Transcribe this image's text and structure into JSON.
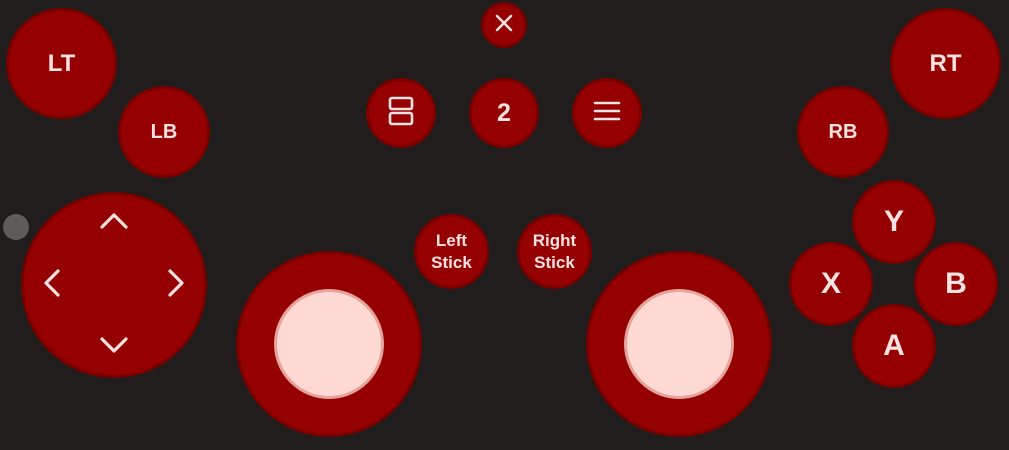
{
  "colors": {
    "background": "#211d1d",
    "button_fill": "#950000",
    "button_border": "#7a0000",
    "button_text": "#fbe1e1",
    "stick_knob": "#ffd9d4",
    "drag_handle": "#5e5b5b"
  },
  "top_controls": {
    "close_icon": "close-icon",
    "view_icon": "view-toggle-icon",
    "page_label": "2",
    "menu_icon": "menu-icon"
  },
  "triggers": {
    "lt": "LT",
    "rt": "RT",
    "lb": "LB",
    "rb": "RB"
  },
  "stick_buttons": {
    "left_line1": "Left",
    "left_line2": "Stick",
    "right_line1": "Right",
    "right_line2": "Stick"
  },
  "face_buttons": {
    "y": "Y",
    "x": "X",
    "b": "B",
    "a": "A"
  },
  "dpad": {
    "up_icon": "chevron-up-icon",
    "down_icon": "chevron-down-icon",
    "left_icon": "chevron-left-icon",
    "right_icon": "chevron-right-icon"
  }
}
